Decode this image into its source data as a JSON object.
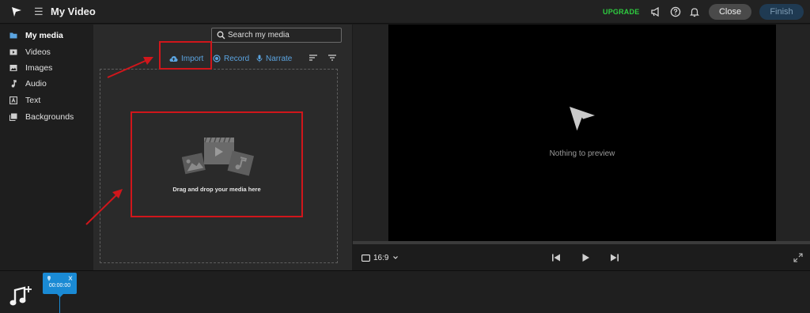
{
  "topbar": {
    "title": "My Video",
    "upgrade_label": "UPGRADE",
    "close_label": "Close",
    "finish_label": "Finish",
    "upgrade_color": "#2ecc40",
    "icons": [
      "logo-icon",
      "menu-icon",
      "announcement-icon",
      "help-icon",
      "notification-bell-icon"
    ]
  },
  "sidebar": {
    "items": [
      {
        "label": "My media",
        "icon": "folder-icon",
        "active": true
      },
      {
        "label": "Videos",
        "icon": "video-icon",
        "active": false
      },
      {
        "label": "Images",
        "icon": "image-icon",
        "active": false
      },
      {
        "label": "Audio",
        "icon": "music-note-icon",
        "active": false
      },
      {
        "label": "Text",
        "icon": "text-icon",
        "active": false
      },
      {
        "label": "Backgrounds",
        "icon": "backgrounds-icon",
        "active": false
      }
    ]
  },
  "media": {
    "search_placeholder": "Search my media",
    "import_label": "Import",
    "record_label": "Record",
    "narrate_label": "Narrate",
    "drop_text": "Drag and drop your media here",
    "accent_color": "#5ba4e0"
  },
  "preview": {
    "empty_text": "Nothing to preview",
    "aspect_ratio": "16:9"
  },
  "timeline": {
    "playhead_time": "00:00:00",
    "playhead_color": "#1a8ad4"
  },
  "annotations": {
    "highlight_color": "#d0161b"
  }
}
